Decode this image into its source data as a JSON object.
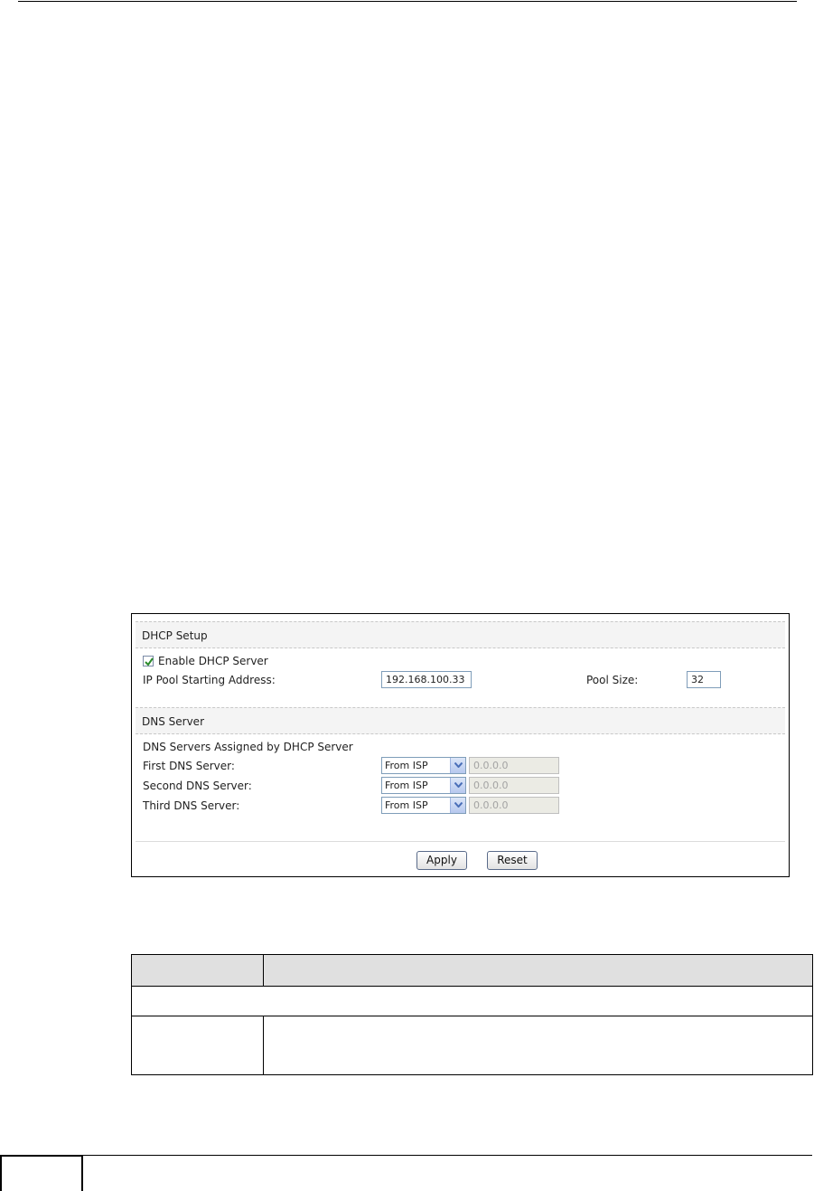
{
  "dhcp_screen": {
    "section_dhcp_title": "DHCP Setup",
    "enable_dhcp_label": "Enable DHCP Server",
    "enable_dhcp_checked": true,
    "ip_pool_label": "IP Pool Starting Address:",
    "ip_pool_value": "192.168.100.33",
    "pool_size_label": "Pool Size:",
    "pool_size_value": "32",
    "section_dns_title": "DNS Server",
    "dns_assigned_label": "DNS Servers Assigned by DHCP Server",
    "dns_rows": [
      {
        "label": "First DNS Server:",
        "selected": "From ISP",
        "ip_value": "0.0.0.0"
      },
      {
        "label": "Second DNS Server:",
        "selected": "From ISP",
        "ip_value": "0.0.0.0"
      },
      {
        "label": "Third DNS Server:",
        "selected": "From ISP",
        "ip_value": "0.0.0.0"
      }
    ],
    "apply_label": "Apply",
    "reset_label": "Reset"
  },
  "description_table": {
    "header_label_col": "",
    "header_desc_col": "",
    "section_row": "",
    "row_label": "",
    "row_desc": ""
  },
  "footer": {
    "page_number": ""
  },
  "colors": {
    "checkbox_check": "#2a8a2a",
    "select_arrow": "#4a6fb8",
    "section_bar_bg": "#f4f4f4",
    "table_header_bg": "#e0e0e0"
  }
}
